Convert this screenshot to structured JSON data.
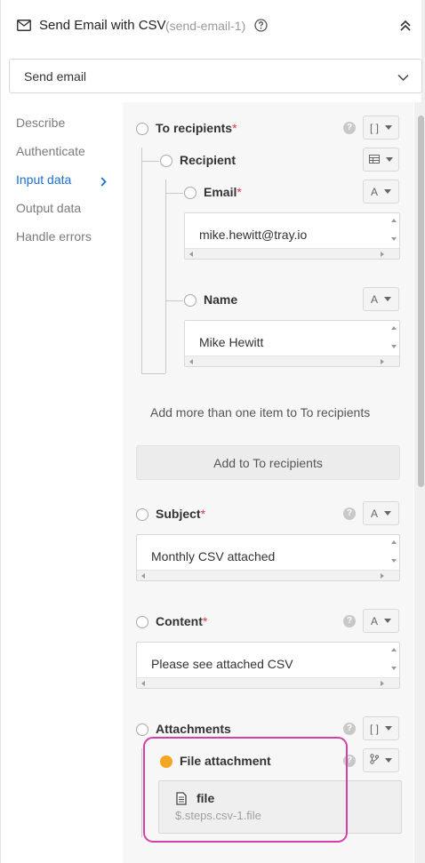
{
  "header": {
    "title": "Send Email with CSV",
    "step_id": "(send-email-1)",
    "help_icon": "help-circle-icon",
    "collapse_icon": "double-chevron-up-icon"
  },
  "operation": {
    "value": "Send email"
  },
  "nav": {
    "items": [
      {
        "label": "Describe",
        "active": false
      },
      {
        "label": "Authenticate",
        "active": false
      },
      {
        "label": "Input data",
        "active": true
      },
      {
        "label": "Output data",
        "active": false
      },
      {
        "label": "Handle errors",
        "active": false
      }
    ]
  },
  "fields": {
    "to_recipients": {
      "label": "To recipients",
      "required": "*",
      "type_icon": "array-icon"
    },
    "recipient": {
      "label": "Recipient",
      "type_icon": "table-icon"
    },
    "email": {
      "label": "Email",
      "required": "*",
      "type_icon": "text-icon",
      "value": "mike.hewitt@tray.io"
    },
    "name": {
      "label": "Name",
      "type_icon": "text-icon",
      "value": "Mike Hewitt"
    },
    "add_more_text": "Add more than one item to To recipients",
    "add_button": "Add to To recipients",
    "subject": {
      "label": "Subject",
      "required": "*",
      "type_icon": "text-icon",
      "value": "Monthly CSV attached"
    },
    "content": {
      "label": "Content",
      "required": "*",
      "type_icon": "text-icon",
      "value": "Please see attached CSV"
    },
    "attachments": {
      "label": "Attachments",
      "type_icon": "array-icon"
    },
    "file_attachment": {
      "label": "File attachment",
      "type_icon": "branch-icon",
      "file_name": "file",
      "file_path": "$.steps.csv-1.file"
    }
  },
  "colors": {
    "accent": "#1c6fd1",
    "required": "#e0344a",
    "highlight": "#d63fa9",
    "status_orange": "#f5a623"
  }
}
